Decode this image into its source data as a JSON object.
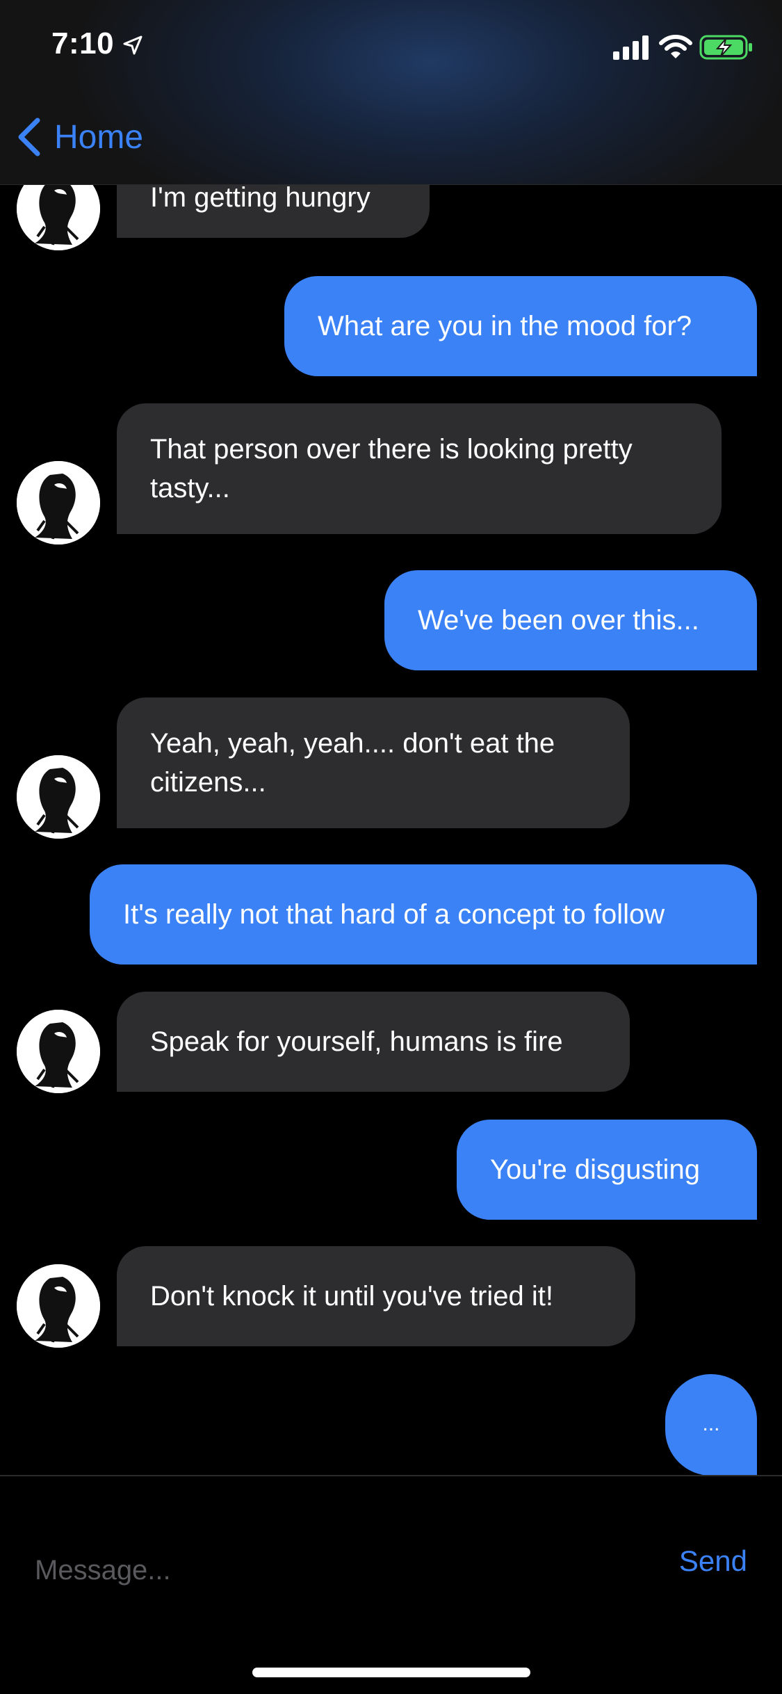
{
  "status_bar": {
    "time": "7:10",
    "icons": [
      "location-arrow-icon",
      "cellular-signal-icon",
      "wifi-icon",
      "battery-charging-icon"
    ],
    "battery_color": "#4cd964"
  },
  "header": {
    "back_label": "Home",
    "accent_color": "#3b82f6"
  },
  "messages": [
    {
      "from": "them",
      "text": "I'm getting hungry"
    },
    {
      "from": "me",
      "text": "What are you in the mood for?"
    },
    {
      "from": "them",
      "text": "That person over there is looking pretty tasty..."
    },
    {
      "from": "me",
      "text": "We've been over this..."
    },
    {
      "from": "them",
      "text": "Yeah, yeah, yeah.... don't eat the citizens..."
    },
    {
      "from": "me",
      "text": "It's really not that hard of a concept to follow"
    },
    {
      "from": "them",
      "text": "Speak for yourself, humans is fire"
    },
    {
      "from": "me",
      "text": "You're disgusting"
    },
    {
      "from": "them",
      "text": "Don't knock it until you've tried it!"
    },
    {
      "from": "me",
      "text": "..."
    }
  ],
  "composer": {
    "placeholder": "Message...",
    "send_label": "Send"
  }
}
